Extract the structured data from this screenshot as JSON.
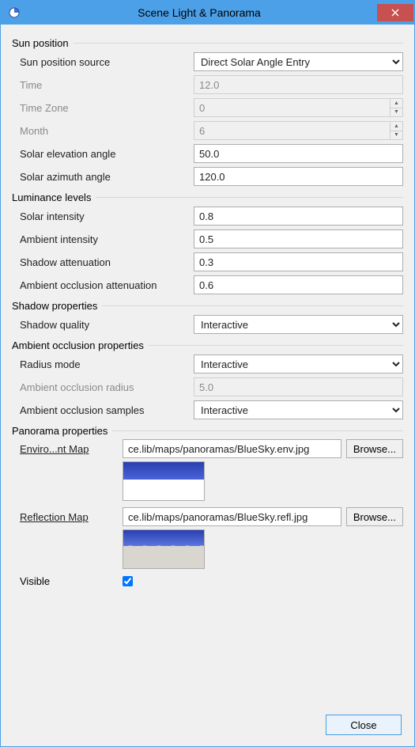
{
  "window": {
    "title": "Scene Light & Panorama"
  },
  "groups": {
    "sunpos": "Sun position",
    "lum": "Luminance levels",
    "shadow": "Shadow properties",
    "ao": "Ambient occlusion properties",
    "pano": "Panorama properties"
  },
  "labels": {
    "sunSource": "Sun position source",
    "time": "Time",
    "timeZone": "Time Zone",
    "month": "Month",
    "solarElev": "Solar elevation angle",
    "solarAzim": "Solar azimuth angle",
    "solarInt": "Solar intensity",
    "ambInt": "Ambient intensity",
    "shadowAtt": "Shadow attenuation",
    "aoAtt": "Ambient occlusion attenuation",
    "shadowQual": "Shadow quality",
    "radiusMode": "Radius mode",
    "aoRadius": "Ambient occlusion radius",
    "aoSamples": "Ambient occlusion samples",
    "envMap": "Enviro...nt Map",
    "reflMap": "Reflection Map",
    "visible": "Visible",
    "browse": "Browse...",
    "close": "Close"
  },
  "values": {
    "sunSource": "Direct Solar Angle Entry",
    "time": "12.0",
    "timeZone": "0",
    "month": "6",
    "solarElev": "50.0",
    "solarAzim": "120.0",
    "solarInt": "0.8",
    "ambInt": "0.5",
    "shadowAtt": "0.3",
    "aoAtt": "0.6",
    "shadowQual": "Interactive",
    "radiusMode": "Interactive",
    "aoRadius": "5.0",
    "aoSamples": "Interactive",
    "envMap": "ce.lib/maps/panoramas/BlueSky.env.jpg",
    "reflMap": "ce.lib/maps/panoramas/BlueSky.refl.jpg",
    "visible": true
  }
}
